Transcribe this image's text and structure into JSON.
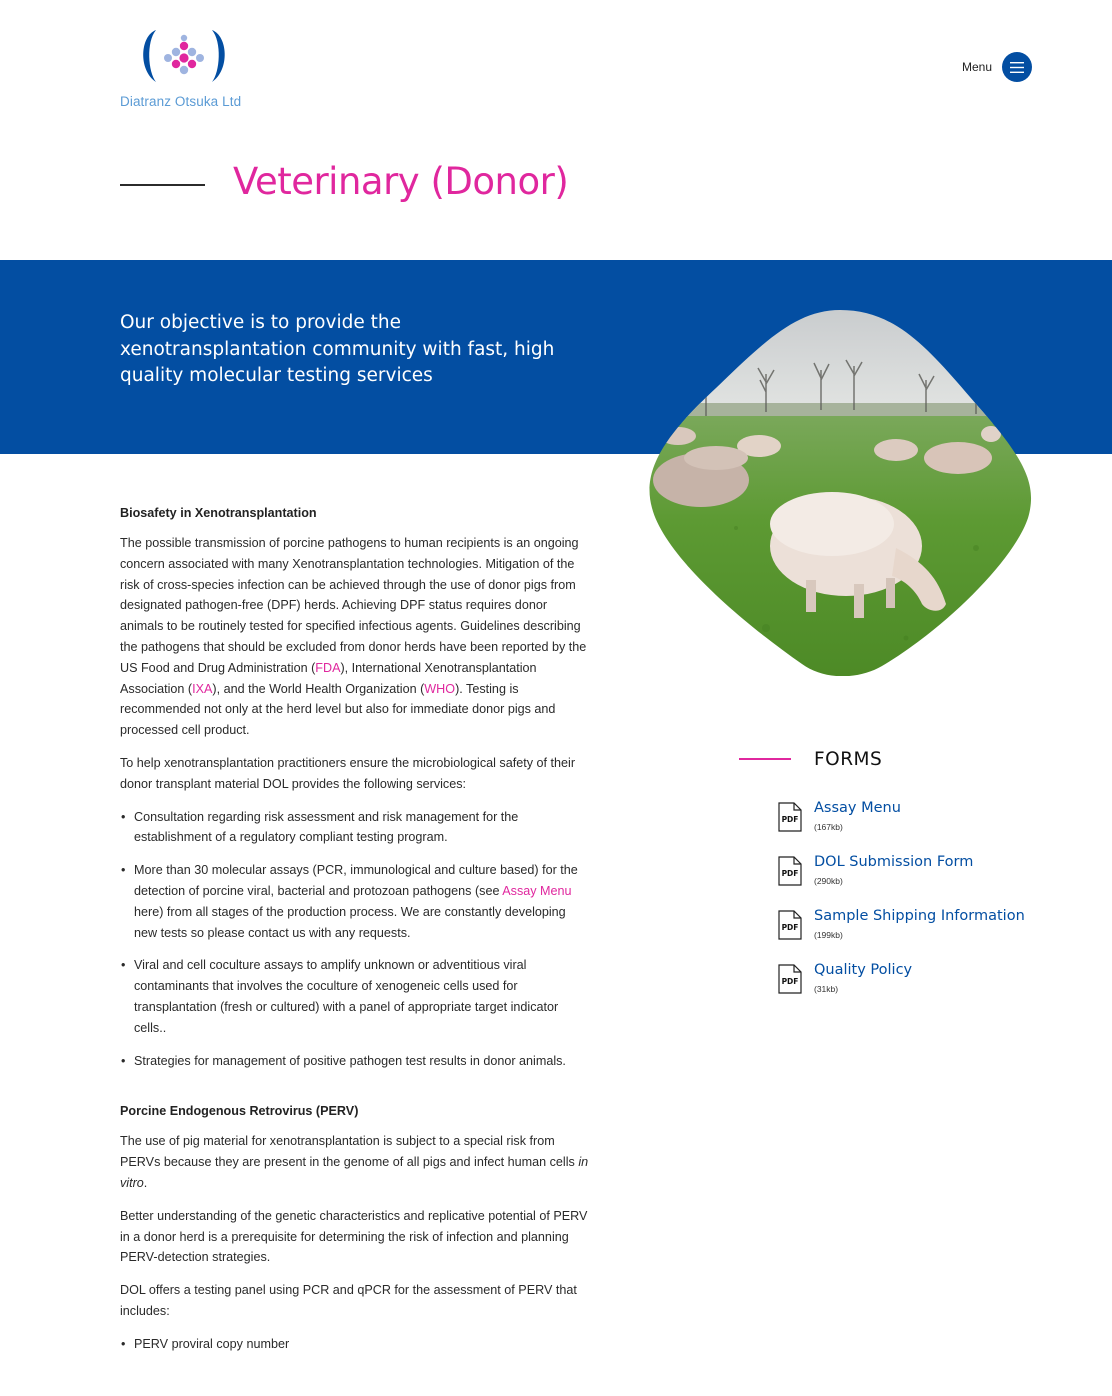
{
  "header": {
    "logo_text": "Diatranz Otsuka Ltd",
    "menu_label": "Menu"
  },
  "page": {
    "title": "Veterinary (Donor)"
  },
  "hero": {
    "tagline": "Our objective is to provide the xenotransplantation community with fast, high quality molecular testing services"
  },
  "colors": {
    "brand_blue": "#034ea2",
    "accent_pink": "#e0279e"
  },
  "content": {
    "section1_heading": "Biosafety in Xenotransplantation",
    "p1_a": "The possible transmission of porcine pathogens to human recipients is an ongoing concern associated with many Xenotransplantation technologies.  Mitigation of the risk of cross-species infection can be achieved through the use of donor pigs from designated pathogen-free (DPF) herds. Achieving DPF status requires donor animals to be routinely tested for specified infectious agents. Guidelines describing the pathogens that should be excluded from donor herds have been reported by the US Food and Drug Administration (",
    "p1_link_fda": "FDA",
    "p1_b": "), International Xenotransplantation Association (",
    "p1_link_ixa": "IXA",
    "p1_c": "), and the World Health Organization (",
    "p1_link_who": "WHO",
    "p1_d": "). Testing is recommended not only at the herd level but also for immediate donor pigs and processed cell product.",
    "p2": "To help xenotransplantation practitioners ensure the microbiological safety of their donor transplant material DOL provides the following services:",
    "bullet1": "Consultation regarding risk assessment and risk management for the establishment of a regulatory compliant testing program.",
    "bullet2_a": "More than 30 molecular assays (PCR, immunological and culture based) for the detection of porcine viral, bacterial and protozoan pathogens (see ",
    "bullet2_link": "Assay Menu",
    "bullet2_b": " here) from all stages of the production process. We are constantly developing new tests so please contact us with any requests.",
    "bullet3": "Viral and cell coculture assays to amplify unknown or adventitious viral contaminants that involves the coculture of xenogeneic cells used for transplantation (fresh or cultured) with a panel of appropriate target indicator cells..",
    "bullet4": "Strategies for management of positive pathogen test results in donor animals.",
    "section2_heading": "Porcine Endogenous Retrovirus (PERV)",
    "p3_a": "The use of pig material for xenotransplantation is subject to a special risk from PERVs because they are present in the genome of all pigs and infect human cells ",
    "p3_em": "in vitro",
    "p3_b": ".",
    "p4": "Better understanding of the genetic characteristics and replicative potential of PERV in a donor herd is a prerequisite for determining the risk of infection and planning PERV-detection strategies.",
    "p5": "DOL offers a testing panel using PCR and qPCR for the assessment of PERV that includes:",
    "bullet5": "PERV proviral copy number"
  },
  "forms": {
    "title": "FORMS",
    "items": [
      {
        "label": "Assay Menu",
        "size": "(167kb)",
        "icon": "pdf-icon"
      },
      {
        "label": "DOL Submission Form",
        "size": "(290kb)",
        "icon": "pdf-icon"
      },
      {
        "label": "Sample Shipping Information",
        "size": "(199kb)",
        "icon": "pdf-icon"
      },
      {
        "label": "Quality Policy",
        "size": "(31kb)",
        "icon": "pdf-icon"
      }
    ],
    "pdf_badge": "PDF"
  }
}
